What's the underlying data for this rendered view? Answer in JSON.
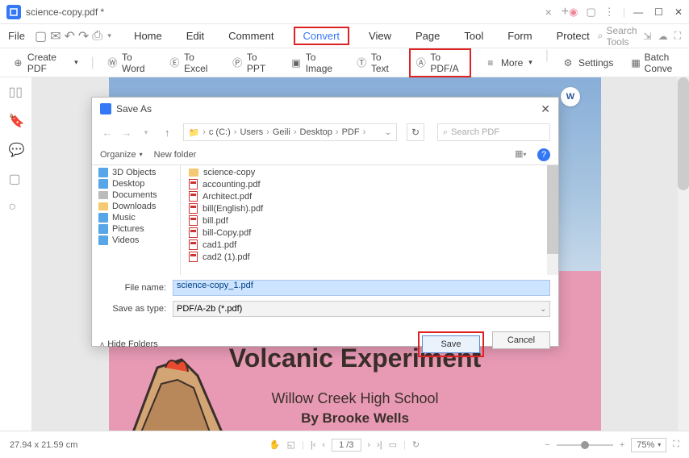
{
  "titlebar": {
    "tab_title": "science-copy.pdf *"
  },
  "menubar": {
    "file": "File",
    "items": [
      "Home",
      "Edit",
      "Comment",
      "Convert",
      "View",
      "Page",
      "Tool",
      "Form",
      "Protect"
    ],
    "search_placeholder": "Search Tools"
  },
  "toolbar": {
    "create_pdf": "Create PDF",
    "to_word": "To Word",
    "to_excel": "To Excel",
    "to_ppt": "To PPT",
    "to_image": "To Image",
    "to_text": "To Text",
    "to_pdfa": "To PDF/A",
    "more": "More",
    "settings": "Settings",
    "batch": "Batch Conve"
  },
  "dialog": {
    "title": "Save As",
    "breadcrumb": [
      "c (C:)",
      "Users",
      "Geili",
      "Desktop",
      "PDF"
    ],
    "search_placeholder": "Search PDF",
    "organize": "Organize",
    "new_folder": "New folder",
    "tree": [
      "3D Objects",
      "Desktop",
      "Documents",
      "Downloads",
      "Music",
      "Pictures",
      "Videos"
    ],
    "files": [
      {
        "name": "science-copy",
        "type": "folder"
      },
      {
        "name": "accounting.pdf",
        "type": "pdf"
      },
      {
        "name": "Architect.pdf",
        "type": "pdf"
      },
      {
        "name": "bill(English).pdf",
        "type": "pdf"
      },
      {
        "name": "bill.pdf",
        "type": "pdf"
      },
      {
        "name": "bill-Copy.pdf",
        "type": "pdf"
      },
      {
        "name": "cad1.pdf",
        "type": "pdf"
      },
      {
        "name": "cad2 (1).pdf",
        "type": "pdf"
      }
    ],
    "file_name_label": "File name:",
    "file_name_value": "science-copy_1.pdf",
    "save_type_label": "Save as type:",
    "save_type_value": "PDF/A-2b (*.pdf)",
    "hide_folders": "Hide Folders",
    "save": "Save",
    "cancel": "Cancel"
  },
  "doc": {
    "title": "Volcanic Experiment",
    "sub1": "Willow Creek High School",
    "sub2": "By Brooke Wells"
  },
  "statusbar": {
    "dims": "27.94 x 21.59 cm",
    "page": "1 /3",
    "zoom": "75%"
  }
}
